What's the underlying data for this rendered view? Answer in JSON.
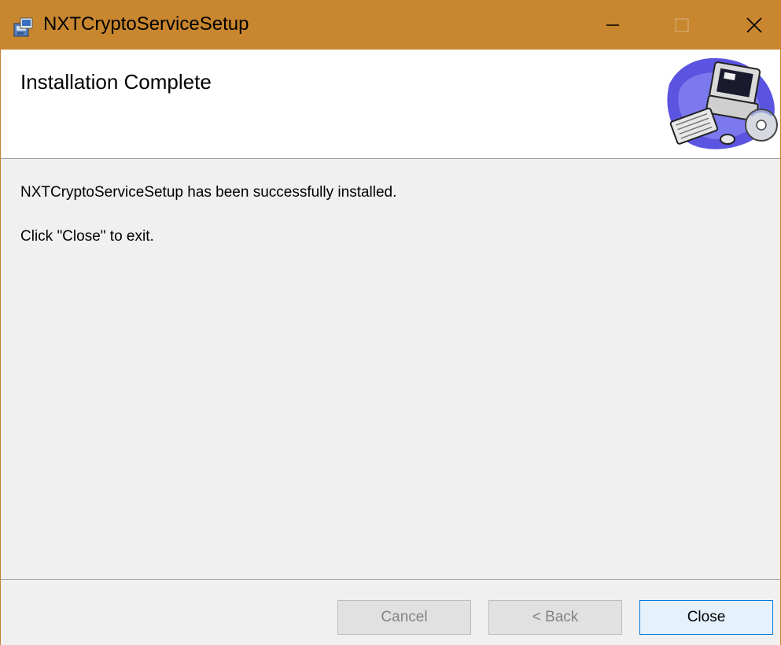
{
  "window": {
    "title": "NXTCryptoServiceSetup",
    "title_bar_color": "#c8862f",
    "app_icon": "installer-icon",
    "controls": {
      "minimize_icon": "minimize-icon",
      "maximize_icon": "maximize-icon",
      "close_icon": "close-icon"
    }
  },
  "header": {
    "title": "Installation Complete",
    "graphic": "computer-illustration-icon"
  },
  "body": {
    "message": "NXTCryptoServiceSetup has been successfully installed.",
    "instruction": "Click \"Close\" to exit."
  },
  "buttons": {
    "cancel_label": "Cancel",
    "cancel_enabled": false,
    "back_label": "< Back",
    "back_enabled": false,
    "close_label": "Close",
    "close_enabled": true,
    "close_border_color": "#0078d7"
  }
}
